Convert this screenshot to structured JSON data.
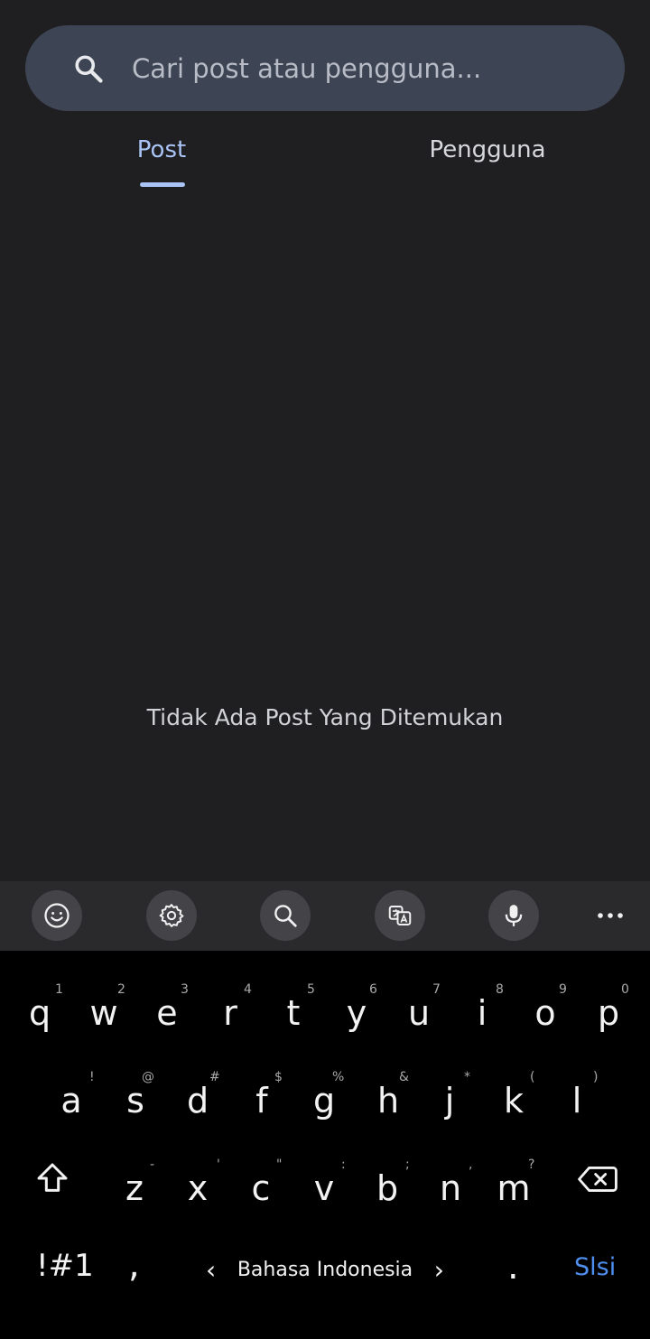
{
  "search": {
    "placeholder": "Cari post atau pengguna...",
    "value": ""
  },
  "tabs": [
    {
      "label": "Post",
      "active": true
    },
    {
      "label": "Pengguna",
      "active": false
    }
  ],
  "empty_message": "Tidak Ada Post Yang Ditemukan",
  "colors": {
    "background": "#1f1f21",
    "search_bg": "#3d4453",
    "accent": "#a9c4f5",
    "keyboard_bg": "#000000",
    "enter_key": "#4f8ff0"
  },
  "keyboard_toolbar": [
    "emoji-icon",
    "settings-icon",
    "search-icon",
    "translate-icon",
    "microphone-icon",
    "more-icon"
  ],
  "keyboard": {
    "row1": [
      {
        "key": "q",
        "hint": "1"
      },
      {
        "key": "w",
        "hint": "2"
      },
      {
        "key": "e",
        "hint": "3"
      },
      {
        "key": "r",
        "hint": "4"
      },
      {
        "key": "t",
        "hint": "5"
      },
      {
        "key": "y",
        "hint": "6"
      },
      {
        "key": "u",
        "hint": "7"
      },
      {
        "key": "i",
        "hint": "8"
      },
      {
        "key": "o",
        "hint": "9"
      },
      {
        "key": "p",
        "hint": "0"
      }
    ],
    "row2": [
      {
        "key": "a",
        "hint": "!"
      },
      {
        "key": "s",
        "hint": "@"
      },
      {
        "key": "d",
        "hint": "#"
      },
      {
        "key": "f",
        "hint": "$"
      },
      {
        "key": "g",
        "hint": "%"
      },
      {
        "key": "h",
        "hint": "&"
      },
      {
        "key": "j",
        "hint": "*"
      },
      {
        "key": "k",
        "hint": "("
      },
      {
        "key": "l",
        "hint": ")"
      }
    ],
    "row3": [
      {
        "key": "z",
        "hint": "-"
      },
      {
        "key": "x",
        "hint": "'"
      },
      {
        "key": "c",
        "hint": "\""
      },
      {
        "key": "v",
        "hint": ":"
      },
      {
        "key": "b",
        "hint": ";"
      },
      {
        "key": "n",
        "hint": ","
      },
      {
        "key": "m",
        "hint": "?"
      }
    ],
    "symbols_label": "!#1",
    "comma": ",",
    "language": "Bahasa Indonesia",
    "period": ".",
    "enter_label": "Slsi"
  }
}
